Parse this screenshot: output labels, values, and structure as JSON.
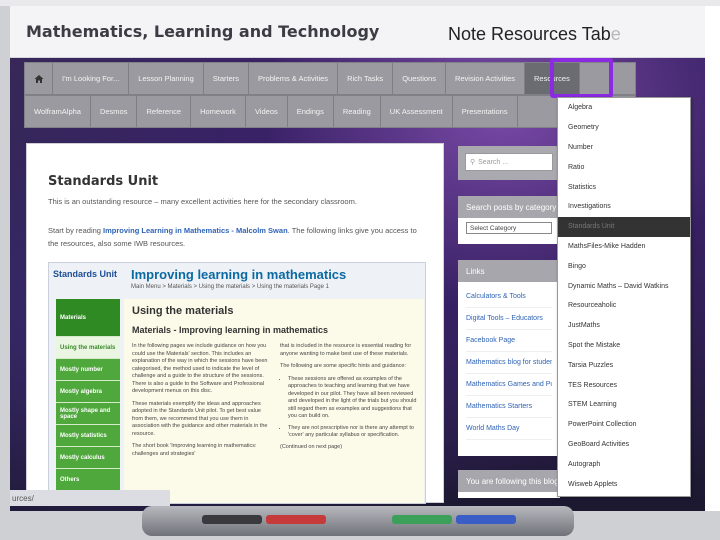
{
  "header": {
    "site_title": "Mathematics, Learning and Technology",
    "note_main": "Note Resources Tab",
    "note_faded": "e"
  },
  "nav": {
    "row1": [
      "I'm Looking For...",
      "Lesson Planning",
      "Starters",
      "Problems & Activities",
      "Rich Tasks",
      "Questions",
      "Revision Activities",
      "Resources"
    ],
    "row2": [
      "WolframAlpha",
      "Desmos",
      "Reference",
      "Homework",
      "Videos",
      "Endings",
      "Reading",
      "UK Assessment",
      "Presentations"
    ]
  },
  "content": {
    "title": "Standards Unit",
    "intro": "This is an outstanding resource – many excellent activities here for the secondary classroom.",
    "start_prefix": "Start by reading ",
    "start_link": "Improving Learning in Mathematics - Malcolm Swan",
    "start_suffix": ". The following links give you access to the resources, also some IWB resources.",
    "embedded": {
      "logo": "Standards Unit",
      "title": "Improving learning in mathematics",
      "breadcrumb": "Main Menu > Materials > Using the materials > Using the materials Page 1",
      "side": [
        "Materials",
        "Using the materials",
        "Mostly number",
        "Mostly algebra",
        "Mostly shape and space",
        "Mostly statistics",
        "Mostly calculus",
        "Others"
      ],
      "h1": "Using the materials",
      "h2": "Materials - Improving learning in mathematics",
      "col1_p1": "In the following pages we include guidance on how you could use the Materials' section. This includes an explanation of the way in which the sessions have been categorised, the method used to indicate the level of challenge and a guide to the structure of the sessions. There is also a guide to the Software and Professional development menus on this disc.",
      "col1_p2": "These materials exemplify the ideas and approaches adopted in the Standards Unit pilot. To get best value from them, we recommend that you use them in association with the guidance and other materials in the resource.",
      "col1_p3": "The short book 'Improving learning in mathematics: challenges and strategies'",
      "col2_p1": "that is included in the resource is essential reading for anyone wanting to make best use of these materials.",
      "col2_p2": "The following are some specific hints and guidance:",
      "col2_li1": "These sessions are offered as examples of the approaches to teaching and learning that we have developed in our pilot. They have all been reviewed and developed in the light of the trials but you should still regard them as examples and suggestions that you can build on.",
      "col2_li2": "They are not prescriptive nor is there any attempt to 'cover' any particular syllabus or specification.",
      "continued": "(Continued on next page)"
    }
  },
  "sidebar": {
    "search_placeholder": "Search ...",
    "category_head": "Search posts by category",
    "category_select": "Select Category",
    "links_head": "Links",
    "links": [
      "Calculators & Tools",
      "Digital Tools – Educators",
      "Facebook Page",
      "Mathematics blog for students",
      "Mathematics Games and Puzzles",
      "Mathematics Starters",
      "World Maths Day"
    ],
    "following_head": "You are following this blog"
  },
  "dropdown": {
    "items": [
      "Algebra",
      "Geometry",
      "Number",
      "Ratio",
      "Statistics",
      "Investigations",
      "Standards Unit",
      "MathsFiles-Mike Hadden",
      "Bingo",
      "Dynamic Maths – David Watkins",
      "Resourceaholic",
      "JustMaths",
      "Spot the Mistake",
      "Tarsia Puzzles",
      "TES Resources",
      "STEM Learning",
      "PowerPoint Collection",
      "GeoBoard Activities",
      "Autograph",
      "Wisweb Applets"
    ],
    "selected_index": 6
  },
  "status": {
    "url_fragment": "urces/"
  },
  "colors": {
    "highlight": "#8a2be2",
    "link": "#2f63b4",
    "nav_bg": "#9a9aa0"
  }
}
